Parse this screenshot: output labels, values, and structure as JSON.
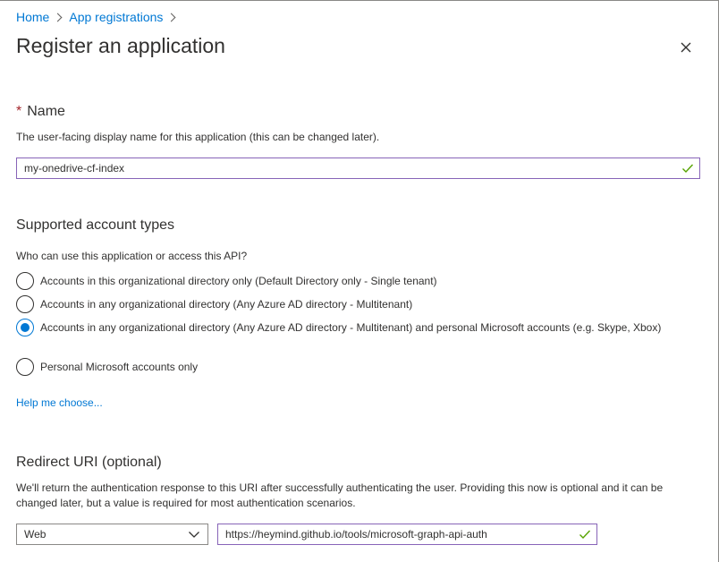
{
  "breadcrumb": {
    "items": [
      {
        "label": "Home"
      },
      {
        "label": "App registrations"
      }
    ]
  },
  "page": {
    "title": "Register an application"
  },
  "name_section": {
    "required_marker": "*",
    "title": "Name",
    "description": "The user-facing display name for this application (this can be changed later).",
    "input_value": "my-onedrive-cf-index"
  },
  "account_types": {
    "title": "Supported account types",
    "question": "Who can use this application or access this API?",
    "options": [
      {
        "label": "Accounts in this organizational directory only (Default Directory only - Single tenant)",
        "selected": false
      },
      {
        "label": "Accounts in any organizational directory (Any Azure AD directory - Multitenant)",
        "selected": false
      },
      {
        "label": "Accounts in any organizational directory (Any Azure AD directory - Multitenant) and personal Microsoft accounts (e.g. Skype, Xbox)",
        "selected": true
      },
      {
        "label": "Personal Microsoft accounts only",
        "selected": false
      }
    ],
    "help_link": "Help me choose..."
  },
  "redirect": {
    "title": "Redirect URI (optional)",
    "description": "We'll return the authentication response to this URI after successfully authenticating the user. Providing this now is optional and it can be changed later, but a value is required for most authentication scenarios.",
    "platform_selected": "Web",
    "uri_value": "https://heymind.github.io/tools/microsoft-graph-api-auth"
  },
  "icons": {
    "close": "close-icon",
    "check": "checkmark-icon",
    "chevron": "chevron-down-icon",
    "crumb_separator": "chevron-right-icon"
  },
  "colors": {
    "accent": "#0078d4",
    "input_border_focus": "#8764b8",
    "valid_check": "#57a300",
    "required": "#a4262c"
  }
}
